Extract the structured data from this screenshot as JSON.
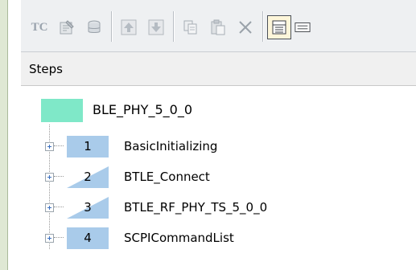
{
  "toolbar": {
    "buttons": [
      {
        "name": "tc-icon",
        "label": "TC"
      },
      {
        "name": "properties-icon"
      },
      {
        "name": "database-icon"
      },
      {
        "name": "move-up-icon"
      },
      {
        "name": "move-down-icon"
      },
      {
        "name": "copy-icon"
      },
      {
        "name": "paste-icon"
      },
      {
        "name": "delete-icon"
      },
      {
        "name": "table-view-icon"
      },
      {
        "name": "list-view-icon"
      }
    ]
  },
  "steps_header": {
    "label": "Steps"
  },
  "tree": {
    "root": {
      "label": "BLE_PHY_5_0_0",
      "color": "#7fe8c8"
    },
    "items": [
      {
        "number": "1",
        "label": "BasicInitializing",
        "style": "full"
      },
      {
        "number": "2",
        "label": "BTLE_Connect",
        "style": "triangle"
      },
      {
        "number": "3",
        "label": "BTLE_RF_PHY_TS_5_0_0",
        "style": "triangle"
      },
      {
        "number": "4",
        "label": "SCPICommandList",
        "style": "full"
      }
    ],
    "item_color": "#a9cbea"
  }
}
